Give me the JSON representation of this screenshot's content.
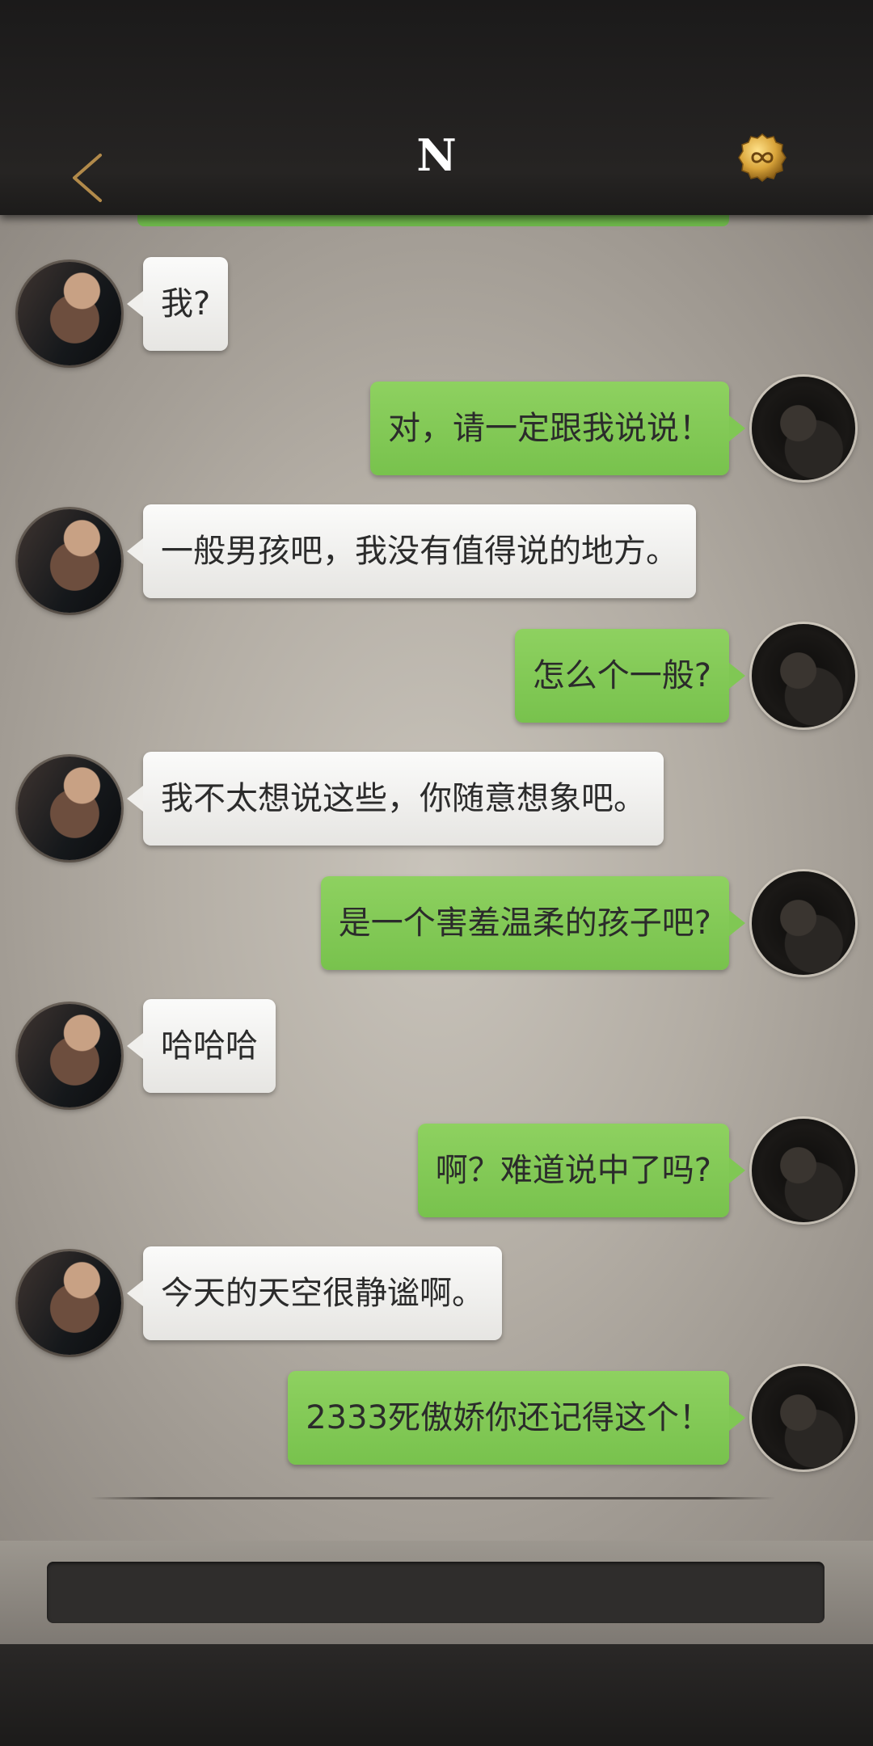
{
  "header": {
    "title": "N",
    "back_icon": "chevron-left-icon",
    "badge_icon": "infinity-coin-icon",
    "accent_color": "#b28a4a"
  },
  "messages": [
    {
      "side": "left",
      "text": "我?"
    },
    {
      "side": "right",
      "text": "对，请一定跟我说说！"
    },
    {
      "side": "left",
      "text": "一般男孩吧，我没有值得说的地方。"
    },
    {
      "side": "right",
      "text": "怎么个一般?"
    },
    {
      "side": "left",
      "text": "我不太想说这些，你随意想象吧。"
    },
    {
      "side": "right",
      "text": "是一个害羞温柔的孩子吧?"
    },
    {
      "side": "left",
      "text": "哈哈哈"
    },
    {
      "side": "right",
      "text": "啊？难道说中了吗?"
    },
    {
      "side": "left",
      "text": "今天的天空很静谧啊。"
    },
    {
      "side": "right",
      "text": "2333死傲娇你还记得这个！"
    }
  ],
  "colors": {
    "incoming_bubble": "#f0efec",
    "outgoing_bubble": "#80c754",
    "bubble_text": "#2b2b2b"
  }
}
